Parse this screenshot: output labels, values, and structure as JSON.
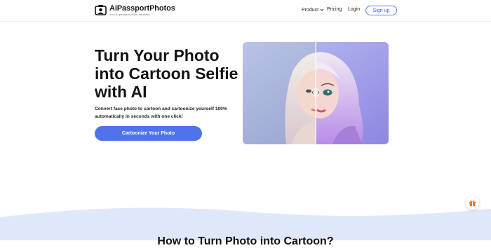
{
  "header": {
    "brand": "AiPassportPhotos",
    "tagline": "Your AI passport photo assistant",
    "nav": {
      "product": "Product",
      "pricing": "Pricing",
      "login": "Login",
      "signup": "Sign up"
    }
  },
  "hero": {
    "title_line1": "Turn Your Photo",
    "title_line2": "into Cartoon Selfie",
    "title_line3": "with AI",
    "desc_line1": "Convert face photo to cartoon and cartoonize yourself 100%",
    "desc_line2": "automatically in seconds with one click!",
    "cta": "Cartoonize Your Photo"
  },
  "section": {
    "how_title": "How to Turn Photo into Cartoon?"
  },
  "colors": {
    "accent": "#4f73ea",
    "wave": "#dfe7fb",
    "gift": "#f26a2e"
  },
  "icons": [
    "logo-camera-icon",
    "chevron-down-icon",
    "compare-slider-icon",
    "gift-icon"
  ]
}
